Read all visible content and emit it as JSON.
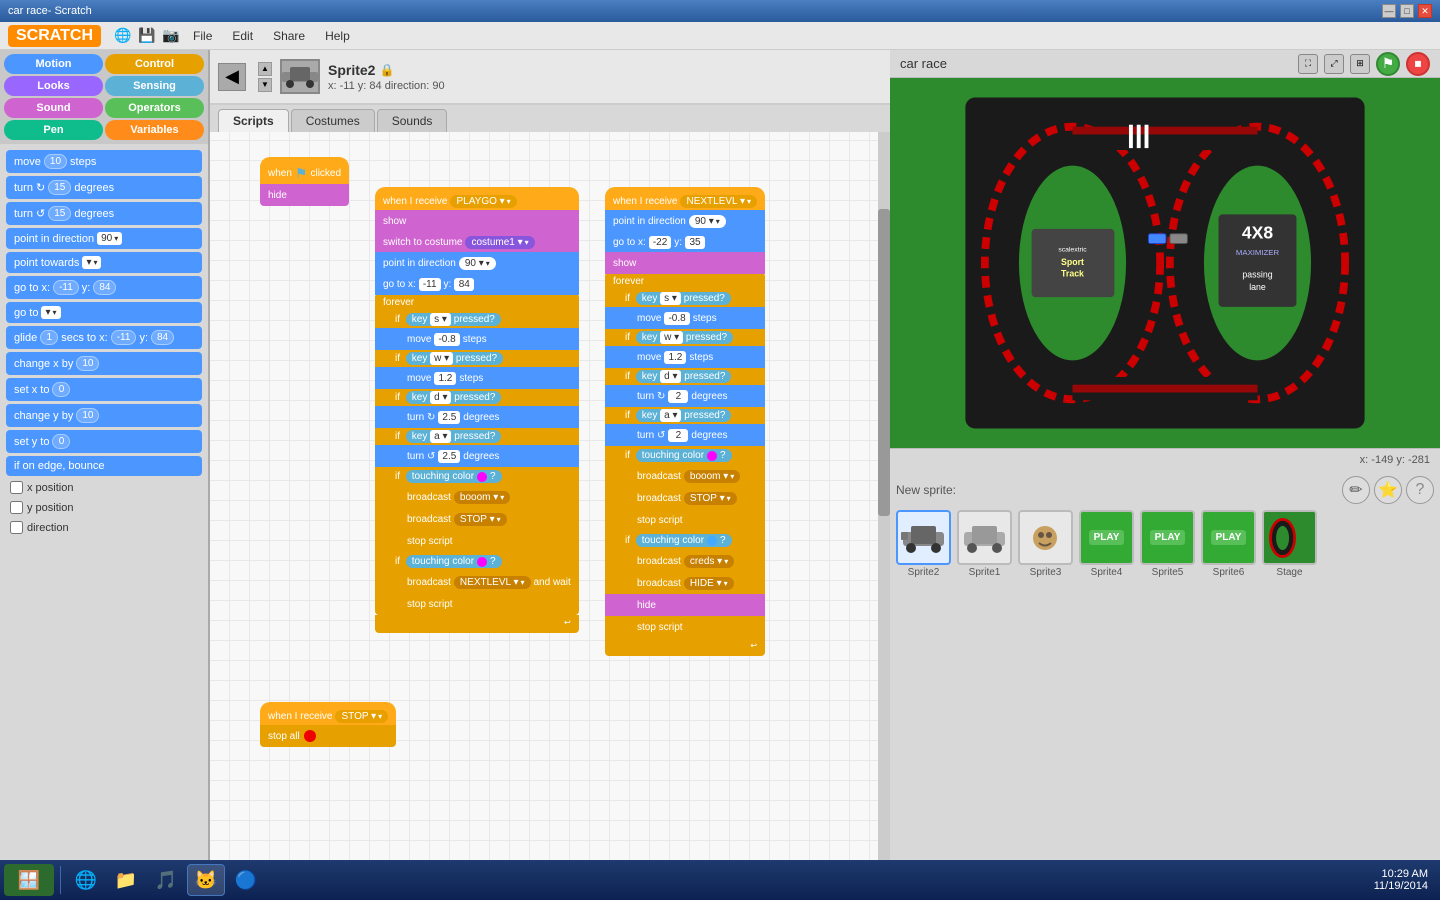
{
  "titlebar": {
    "title": "car race- Scratch",
    "min": "—",
    "max": "□",
    "close": "✕"
  },
  "menubar": {
    "logo": "SCRATCH",
    "items": [
      "File",
      "Edit",
      "Share",
      "Help"
    ]
  },
  "sprite": {
    "name": "Sprite2",
    "x": "-11",
    "y": "84",
    "direction": "90",
    "tabs": [
      "Scripts",
      "Costumes",
      "Sounds"
    ]
  },
  "categories": [
    {
      "id": "motion",
      "label": "Motion",
      "color": "#4c97ff"
    },
    {
      "id": "control",
      "label": "Control",
      "color": "#e6a000"
    },
    {
      "id": "looks",
      "label": "Looks",
      "color": "#9966ff"
    },
    {
      "id": "sensing",
      "label": "Sensing",
      "color": "#5cb1d6"
    },
    {
      "id": "sound",
      "label": "Sound",
      "color": "#cf63cf"
    },
    {
      "id": "operators",
      "label": "Operators",
      "color": "#59c059"
    },
    {
      "id": "pen",
      "label": "Pen",
      "color": "#0fbd8c"
    },
    {
      "id": "variables",
      "label": "Variables",
      "color": "#ff8c1a"
    }
  ],
  "motion_blocks": [
    {
      "label": "move",
      "val1": "10",
      "label2": "steps"
    },
    {
      "label": "turn ↻",
      "val1": "15",
      "label2": "degrees"
    },
    {
      "label": "turn ↺",
      "val1": "15",
      "label2": "degrees"
    },
    {
      "label": "point in direction",
      "val1": "90"
    },
    {
      "label": "point towards",
      "val1": ""
    },
    {
      "label": "go to x:",
      "val1": "-11",
      "label2": "y:",
      "val2": "84"
    },
    {
      "label": "go to",
      "val1": ""
    },
    {
      "label": "glide",
      "val1": "1",
      "label2": "secs to x:",
      "val2": "-11",
      "label3": "y:",
      "val3": "84"
    },
    {
      "label": "change x by",
      "val1": "10"
    },
    {
      "label": "set x to",
      "val1": "0"
    },
    {
      "label": "change y by",
      "val1": "10"
    },
    {
      "label": "set y to",
      "val1": "0"
    },
    {
      "label": "if on edge, bounce"
    },
    {
      "checkbox": "x position"
    },
    {
      "checkbox": "y position"
    },
    {
      "checkbox": "direction"
    }
  ],
  "stage": {
    "title": "car race",
    "coords": "x: -149  y: -281"
  },
  "sprites": [
    {
      "label": "Sprite2",
      "selected": true
    },
    {
      "label": "Sprite1",
      "selected": false
    },
    {
      "label": "Sprite3",
      "selected": false
    },
    {
      "label": "Sprite4",
      "selected": false,
      "play": "PLAY"
    },
    {
      "label": "Sprite5",
      "selected": false,
      "play": "PLAY"
    },
    {
      "label": "Sprite6",
      "selected": false,
      "play": "PLAY"
    }
  ],
  "taskbar": {
    "time": "10:29 AM",
    "date": "11/19/2014"
  }
}
